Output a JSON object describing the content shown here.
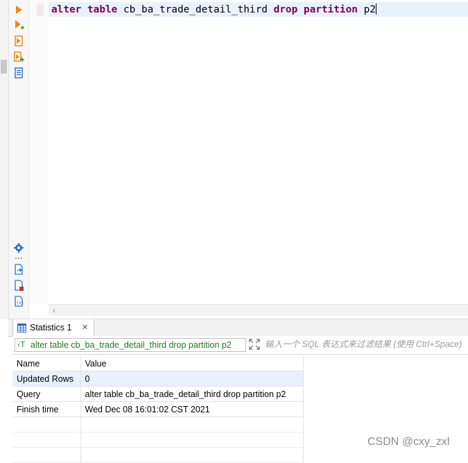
{
  "editor": {
    "code_tokens": [
      {
        "text": "alter",
        "type": "keyword"
      },
      {
        "text": " ",
        "type": "plain"
      },
      {
        "text": "table",
        "type": "keyword"
      },
      {
        "text": " cb_ba_trade_detail_third ",
        "type": "plain"
      },
      {
        "text": "drop",
        "type": "keyword"
      },
      {
        "text": " ",
        "type": "plain"
      },
      {
        "text": "partition",
        "type": "keyword"
      },
      {
        "text": " p2",
        "type": "plain"
      }
    ]
  },
  "toolbar": {
    "tools": [
      {
        "icon": "execute-statement-icon",
        "color": "#e8891e"
      },
      {
        "icon": "execute-new-tab-icon",
        "color": "#e8891e"
      },
      {
        "icon": "execute-script-icon",
        "color": "#e8891e"
      },
      {
        "icon": "execute-script-new-tab-icon",
        "color": "#e8891e"
      },
      {
        "icon": "explain-plan-icon",
        "color": "#2d72c4"
      },
      {
        "icon": "settings-gear-icon",
        "color": "#2d72c4"
      },
      {
        "icon": "export-icon",
        "color": "#2d72c4"
      },
      {
        "icon": "delete-file-icon",
        "color": "#c0392b"
      },
      {
        "icon": "variables-icon",
        "color": "#2d72c4"
      }
    ]
  },
  "results_panel": {
    "tab": {
      "label": "Statistics 1"
    },
    "filter": {
      "query_text": "alter table cb_ba_trade_detail_third drop partition p2",
      "placeholder": "输入一个 SQL 表达式来过滤结果 (使用 Ctrl+Space)"
    },
    "table": {
      "headers": [
        "Name",
        "Value"
      ],
      "rows": [
        {
          "name": "Updated Rows",
          "value": "0"
        },
        {
          "name": "Query",
          "value": "alter table cb_ba_trade_detail_third drop partition p2"
        },
        {
          "name": "Finish time",
          "value": "Wed Dec 08 16:01:02 CST 2021"
        }
      ]
    }
  },
  "watermark": "CSDN @cxy_zxl",
  "colors": {
    "keyword": "#7f0055",
    "current_line": "#e8f2fe",
    "selected_row": "#e6f1fb",
    "filter_text": "#1f7a1f"
  }
}
